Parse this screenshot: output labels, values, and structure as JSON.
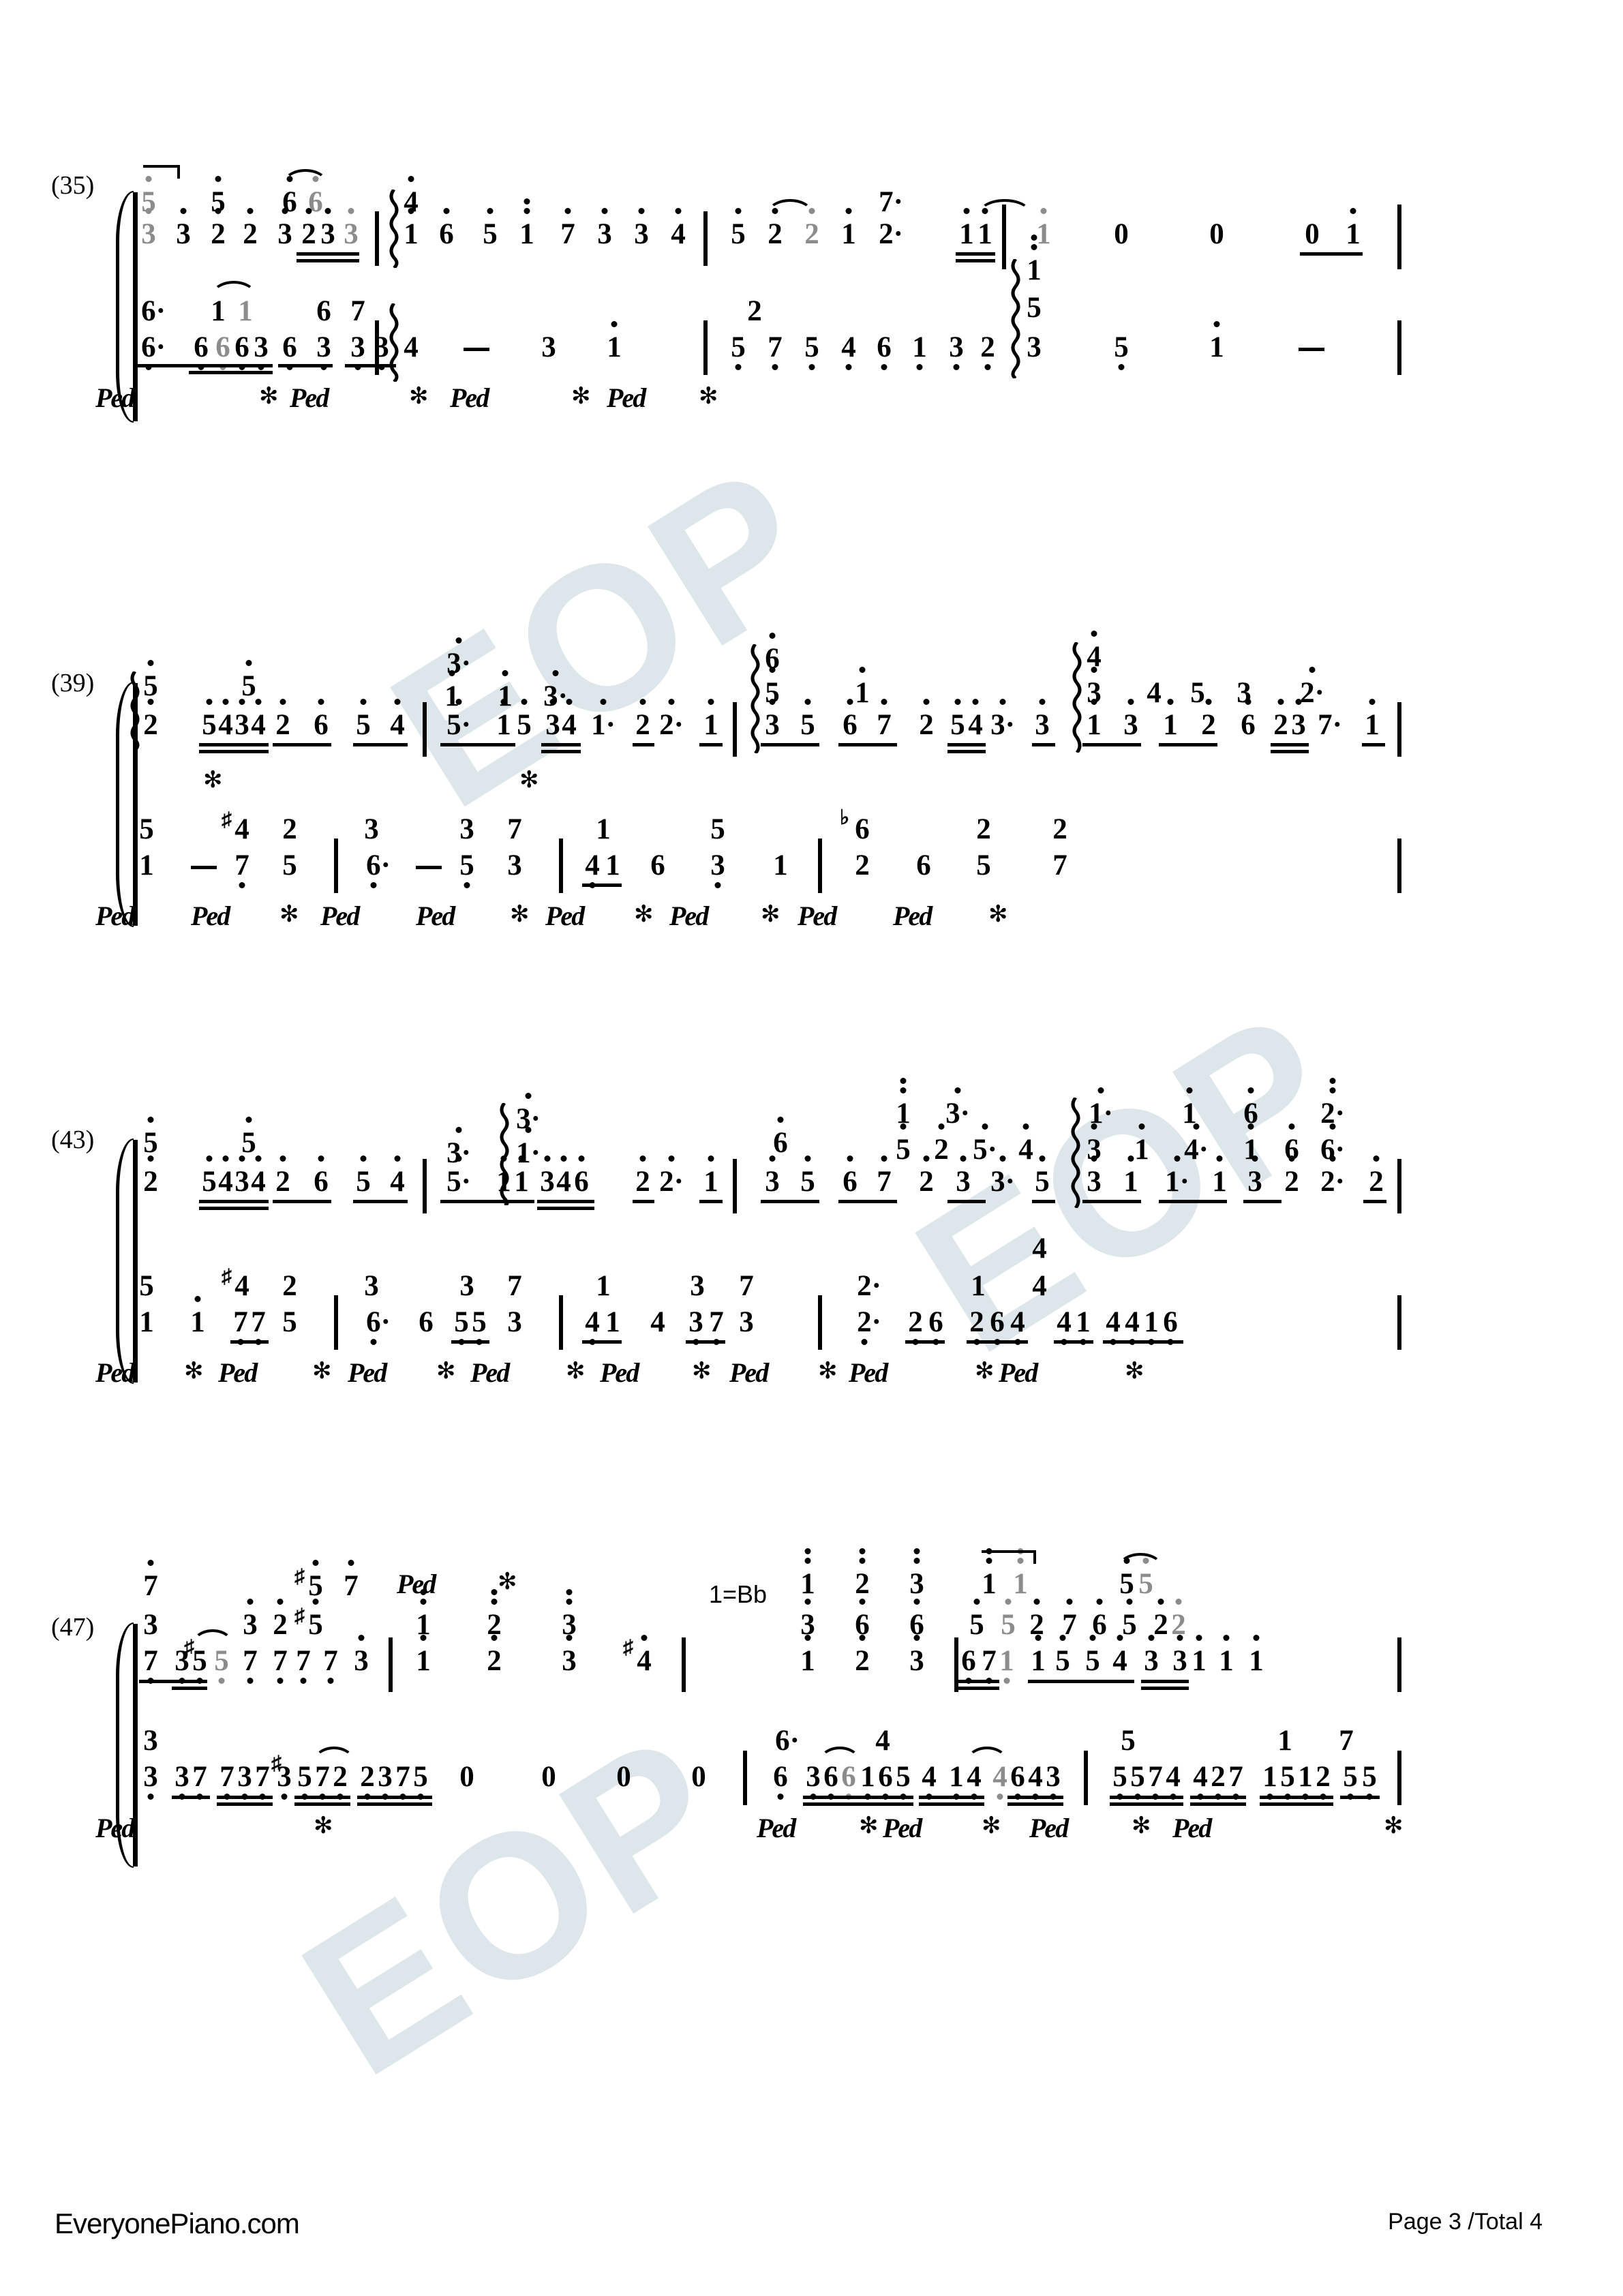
{
  "document": {
    "type": "numbered-musical-notation",
    "instrument": "piano",
    "page_label": "Page 3 /Total 4",
    "site": "EveryonePiano.com",
    "watermark_text": "EOP",
    "key_signature_change": "1=Bb"
  },
  "systems": [
    {
      "measure_label": "(35)",
      "treble": {
        "upper_voice": [
          "5",
          "5",
          "6",
          "6"
        ],
        "lower_voice": [
          "3",
          "3",
          "2",
          "2",
          "3",
          "2",
          "3",
          "3"
        ],
        "measure2": [
          "1",
          "6",
          "5",
          "1",
          "7",
          "3",
          "3",
          "4"
        ],
        "measure3": [
          "5",
          "2",
          "2",
          "1",
          "2·",
          "1",
          "1"
        ],
        "measure4": [
          "1",
          "0",
          "0",
          "0",
          "1"
        ],
        "time_hint": "4"
      },
      "bass": {
        "measure1_upper": [
          "6·",
          "1",
          "1",
          "6",
          "7"
        ],
        "measure1_lower": [
          "6·",
          "6",
          "6",
          "6",
          "3",
          "6",
          "3",
          "3",
          "3"
        ],
        "measure2": [
          "4",
          "-",
          "3",
          "1"
        ],
        "measure3_upper": [
          "2"
        ],
        "measure3": [
          "5",
          "7",
          "5",
          "4",
          "6",
          "1",
          "3",
          "2"
        ],
        "measure4_upper": [
          "1",
          "5"
        ],
        "measure4": [
          "3",
          "5",
          "1",
          "-"
        ]
      }
    },
    {
      "measure_label": "(39)",
      "treble": {
        "m1_upper": [
          "5",
          "5"
        ],
        "m1_lower": [
          "2",
          "5",
          "4",
          "3",
          "4",
          "2",
          "6",
          "5",
          "4"
        ],
        "m2_upper": [
          "3·",
          "1·",
          "1",
          "3·"
        ],
        "m2_lower": [
          "5·",
          "1",
          "5",
          "3",
          "4",
          "1·",
          "2",
          "2·",
          "1"
        ],
        "m3_upper": [
          "6",
          "5",
          "1"
        ],
        "m3_lower": [
          "3",
          "5",
          "6",
          "7",
          "2",
          "5",
          "4",
          "3·",
          "3"
        ],
        "m4_upper": [
          "4",
          "3",
          "4",
          "5",
          "3",
          "2·"
        ],
        "m4_lower": [
          "3",
          "1",
          "3",
          "1",
          "2",
          "6",
          "2",
          "3",
          "7·",
          "1"
        ]
      },
      "bass": {
        "m1_upper": [
          "5",
          "4",
          "2"
        ],
        "m1_lower": [
          "1",
          "-",
          "7",
          "5"
        ],
        "m2_upper": [
          "3",
          "3",
          "7"
        ],
        "m2_lower": [
          "6·",
          "-",
          "5",
          "3"
        ],
        "m3_upper": [
          "1",
          "5"
        ],
        "m3_lower": [
          "4",
          "1",
          "6",
          "3",
          "1"
        ],
        "m4_upper": [
          "6",
          "2",
          "2"
        ],
        "m4_lower": [
          "2",
          "6",
          "5",
          "7"
        ]
      }
    },
    {
      "measure_label": "(43)",
      "treble": {
        "m1_upper": [
          "5",
          "5"
        ],
        "m1_lower": [
          "2",
          "5",
          "4",
          "3",
          "4",
          "2",
          "6",
          "5",
          "4"
        ],
        "m2_upper": [
          "3·",
          "1·"
        ],
        "m2_lower": [
          "5·",
          "1",
          "1",
          "3",
          "4",
          "6",
          "2",
          "2·",
          "1"
        ],
        "m3_upper": [
          "6",
          "1",
          "3·",
          "5",
          "2",
          "5·",
          "4"
        ],
        "m3_lower": [
          "3",
          "5",
          "6",
          "7",
          "2",
          "3",
          "3·",
          "5"
        ],
        "m4_upper": [
          "1·",
          "1",
          "6",
          "3",
          "1",
          "4·",
          "2·"
        ],
        "m4_lower": [
          "3",
          "1",
          "1·",
          "1",
          "3",
          "2",
          "2·",
          "2"
        ]
      },
      "bass": {
        "m1_upper": [
          "5",
          "4",
          "2"
        ],
        "m1_lower": [
          "1",
          "1",
          "7",
          "7",
          "5"
        ],
        "m2_upper": [
          "3",
          "3",
          "7"
        ],
        "m2_lower": [
          "6·",
          "6",
          "5",
          "5",
          "3"
        ],
        "m3_upper": [
          "1",
          "3",
          "7"
        ],
        "m3_lower": [
          "4",
          "1",
          "4",
          "3",
          "7",
          "3"
        ],
        "m4_upper": [
          "4",
          "2·",
          "1",
          "4"
        ],
        "m4_lower": [
          "2·",
          "2",
          "6",
          "2",
          "6",
          "4",
          "4",
          "1",
          "4",
          "4",
          "1",
          "6"
        ]
      }
    },
    {
      "measure_label": "(47)",
      "treble": {
        "m1_upper": [
          "7",
          "5",
          "7"
        ],
        "m1_mid": [
          "3",
          "3",
          "2",
          "5"
        ],
        "m1_lower": [
          "7",
          "3",
          "5",
          "5",
          "7",
          "7",
          "7",
          "7",
          "3"
        ],
        "m2_upper": [
          "1",
          "2",
          "3"
        ],
        "m2_lower": [
          "1",
          "2",
          "3",
          "4"
        ],
        "m3_upper": [
          "1",
          "2",
          "3",
          "1",
          "1",
          "5",
          "5"
        ],
        "m3_mid": [
          "3",
          "6",
          "6",
          "5",
          "5",
          "2",
          "7",
          "6",
          "5",
          "2",
          "2"
        ],
        "m3_lower": [
          "1",
          "2",
          "3",
          "6",
          "7",
          "1",
          "1",
          "5",
          "5",
          "4",
          "3",
          "3",
          "1",
          "1",
          "1"
        ]
      },
      "bass": {
        "m1_upper": [
          "3"
        ],
        "m1_lower": [
          "3",
          "3",
          "7",
          "7",
          "3",
          "7",
          "3",
          "5",
          "7",
          "2",
          "2",
          "3",
          "7",
          "5"
        ],
        "m2": [
          "0",
          "0",
          "0",
          "0"
        ],
        "m3_upper": [
          "6",
          "4",
          "5",
          "1",
          "1",
          "7"
        ],
        "m3_lower": [
          "6",
          "3",
          "6",
          "6",
          "1",
          "6",
          "5",
          "4",
          "1",
          "4",
          "4",
          "6",
          "4",
          "3",
          "5",
          "5",
          "7",
          "4",
          "4",
          "2",
          "7",
          "1",
          "5",
          "1",
          "2",
          "5",
          "5"
        ]
      }
    }
  ],
  "symbols": {
    "pedal_down": "Ped",
    "pedal_up": "✻",
    "sharp": "♯",
    "flat": "♭",
    "rest": "0",
    "sustain_dash": "-"
  }
}
